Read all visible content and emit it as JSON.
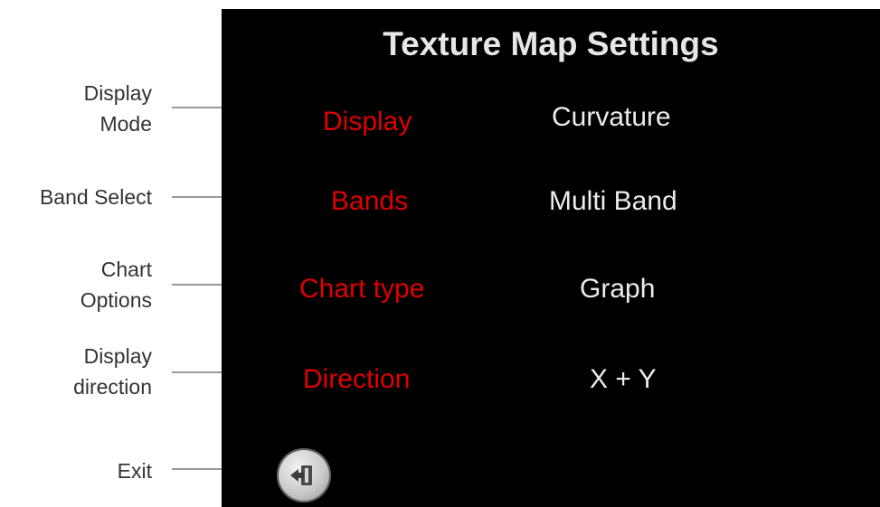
{
  "screen": {
    "title": "Texture Map Settings"
  },
  "settings": [
    {
      "label": "Display",
      "value": "Curvature"
    },
    {
      "label": "Bands",
      "value": "Multi Band"
    },
    {
      "label": "Chart type",
      "value": "Graph"
    },
    {
      "label": "Direction",
      "value": "X + Y"
    }
  ],
  "annotations": [
    {
      "text": "Display\nMode"
    },
    {
      "text": "Band Select"
    },
    {
      "text": "Chart\nOptions"
    },
    {
      "text": "Display\ndirection"
    },
    {
      "text": "Exit"
    }
  ],
  "exit": {
    "icon": "exit-icon"
  },
  "colors": {
    "screen_background": "#000000",
    "setting_label": "#e00000",
    "setting_value": "#ececec",
    "title": "#e6e6e6",
    "annotation_text": "#333333",
    "leader_line": "#9a9a9a"
  }
}
